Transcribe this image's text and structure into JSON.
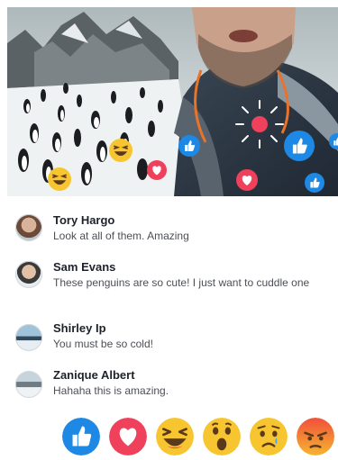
{
  "live_video": {
    "floating_reactions": [
      "like-icon",
      "love-icon",
      "haha-icon",
      "like-icon",
      "love-icon",
      "like-icon",
      "like-icon"
    ]
  },
  "comments": [
    {
      "name": "Tory Hargo",
      "text": "Look at all of them. Amazing"
    },
    {
      "name": "Sam Evans",
      "text": "These penguins are so cute! I just want to cuddle one"
    },
    {
      "name": "Shirley Ip",
      "text": "You must be so cold!"
    },
    {
      "name": "Zanique Albert",
      "text": "Hahaha this is amazing."
    }
  ],
  "reactions": [
    {
      "name": "like",
      "icon": "like-icon",
      "color": "#1e88e5"
    },
    {
      "name": "love",
      "icon": "love-icon",
      "color": "#f0415c"
    },
    {
      "name": "haha",
      "icon": "haha-icon",
      "color": "#f7c530"
    },
    {
      "name": "wow",
      "icon": "wow-icon",
      "color": "#f7c530"
    },
    {
      "name": "sad",
      "icon": "sad-icon",
      "color": "#f7c530"
    },
    {
      "name": "angry",
      "icon": "angry-icon",
      "color": "#f26b36"
    }
  ]
}
